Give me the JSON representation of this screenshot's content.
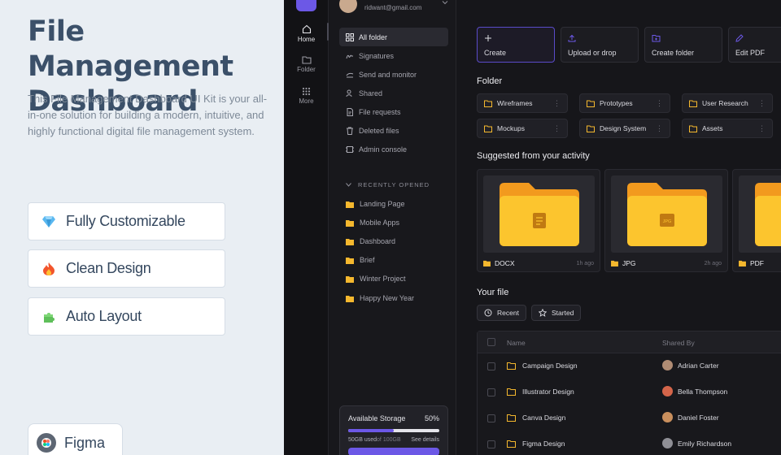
{
  "promo": {
    "title": "File Management Dashboard",
    "description": "This File Management Dashboard UI Kit is your all-in-one solution for building a modern, intuitive, and highly functional digital file management system.",
    "features": [
      {
        "label": "Fully Customizable",
        "icon": "gem-icon"
      },
      {
        "label": "Clean Design",
        "icon": "fire-icon"
      },
      {
        "label": "Auto Layout",
        "icon": "puzzle-icon"
      }
    ],
    "tool": "Figma"
  },
  "rail": {
    "items": [
      {
        "label": "Home",
        "icon": "home-icon"
      },
      {
        "label": "Folder",
        "icon": "folder-icon"
      },
      {
        "label": "More",
        "icon": "grid-icon"
      }
    ]
  },
  "user": {
    "email": "ridwant@gmail.com"
  },
  "sidebar": {
    "nav": [
      {
        "label": "All folder",
        "icon": "grid-icon"
      },
      {
        "label": "Signatures",
        "icon": "signature-icon"
      },
      {
        "label": "Send and monitor",
        "icon": "send-icon"
      },
      {
        "label": "Shared",
        "icon": "users-icon"
      },
      {
        "label": "File requests",
        "icon": "file-request-icon"
      },
      {
        "label": "Deleted files",
        "icon": "trash-icon"
      },
      {
        "label": "Admin console",
        "icon": "console-icon"
      }
    ],
    "recent_header": "RECENTLY OPENED",
    "recent": [
      "Landing Page",
      "Mobile Apps",
      "Dashboard",
      "Brief",
      "Winter Project",
      "Happy New Year"
    ]
  },
  "storage": {
    "title": "Available Storage",
    "percent_label": "50%",
    "used_fraction": 0.5,
    "used": "50GB used",
    "total": "of 100GB",
    "details": "See details"
  },
  "actions": [
    {
      "label": "Create",
      "icon": "plus-icon"
    },
    {
      "label": "Upload or drop",
      "icon": "upload-icon"
    },
    {
      "label": "Create folder",
      "icon": "folder-plus-icon"
    },
    {
      "label": "Edit PDF",
      "icon": "edit-icon"
    }
  ],
  "folder_section": {
    "title": "Folder",
    "folders": [
      "Wireframes",
      "Prototypes",
      "User Research",
      "Mockups",
      "Design System",
      "Assets"
    ]
  },
  "suggested": {
    "title": "Suggested from your activity",
    "items": [
      {
        "badge": "",
        "name": "DOCX",
        "time": "1h ago"
      },
      {
        "badge": "JPG",
        "name": "JPG",
        "time": "2h ago"
      },
      {
        "badge": "",
        "name": "PDF",
        "time": ""
      }
    ]
  },
  "your_file": {
    "title": "Your file",
    "filters": [
      {
        "label": "Recent",
        "icon": "clock-icon"
      },
      {
        "label": "Started",
        "icon": "star-icon"
      }
    ],
    "columns": [
      "Name",
      "Shared By"
    ],
    "rows": [
      {
        "name": "Campaign Design",
        "shared_by": "Adrian Carter"
      },
      {
        "name": "Illustrator Design",
        "shared_by": "Bella Thompson"
      },
      {
        "name": "Canva Design",
        "shared_by": "Daniel Foster"
      },
      {
        "name": "Figma Design",
        "shared_by": "Emily Richardson"
      }
    ]
  },
  "colors": {
    "accent": "#6c58e6",
    "folder_yellow": "#f5b82e",
    "app_bg": "#16161a",
    "promo_bg": "#e9eef3",
    "promo_text": "#3b5069"
  }
}
